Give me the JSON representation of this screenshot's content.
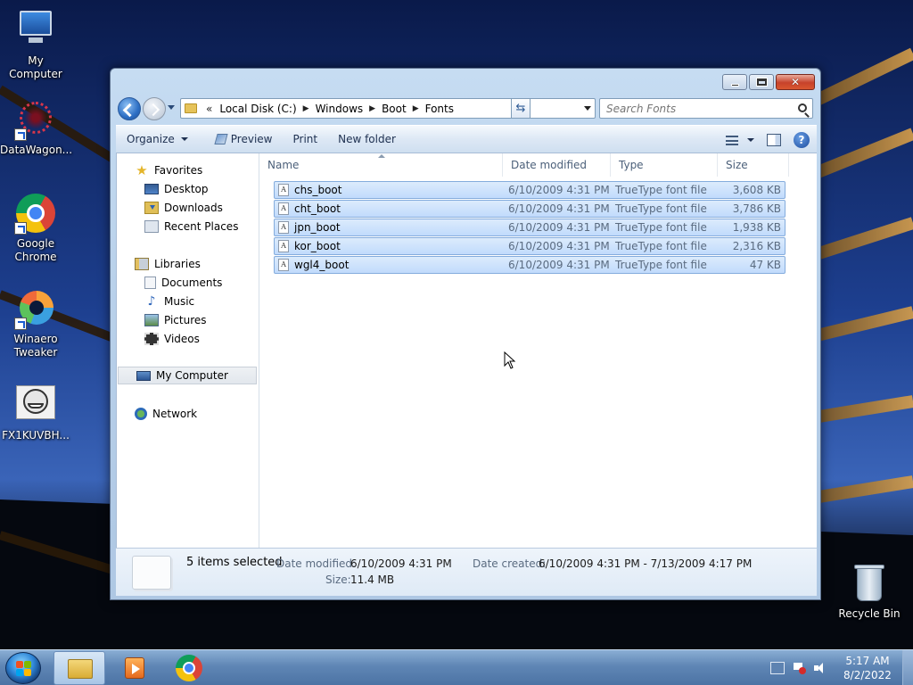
{
  "desktop": {
    "icons": [
      {
        "label": "My Computer"
      },
      {
        "label": "DataWagon..."
      },
      {
        "label": "Google Chrome"
      },
      {
        "label": "Winaero Tweaker"
      },
      {
        "label": "FX1KUVBH..."
      },
      {
        "label": "Recycle Bin"
      }
    ]
  },
  "window": {
    "address": {
      "overflow": "«",
      "segments": [
        "Local Disk (C:)",
        "Windows",
        "Boot",
        "Fonts"
      ]
    },
    "search": {
      "placeholder": "Search Fonts"
    },
    "toolbar": {
      "organize": "Organize",
      "preview": "Preview",
      "print": "Print",
      "new_folder": "New folder"
    },
    "nav": {
      "favorites": "Favorites",
      "desktop": "Desktop",
      "downloads": "Downloads",
      "recent": "Recent Places",
      "libraries": "Libraries",
      "documents": "Documents",
      "music": "Music",
      "pictures": "Pictures",
      "videos": "Videos",
      "computer": "My Computer",
      "network": "Network"
    },
    "columns": {
      "name": "Name",
      "date": "Date modified",
      "type": "Type",
      "size": "Size"
    },
    "files": [
      {
        "name": "chs_boot",
        "date": "6/10/2009 4:31 PM",
        "type": "TrueType font file",
        "size": "3,608 KB"
      },
      {
        "name": "cht_boot",
        "date": "6/10/2009 4:31 PM",
        "type": "TrueType font file",
        "size": "3,786 KB"
      },
      {
        "name": "jpn_boot",
        "date": "6/10/2009 4:31 PM",
        "type": "TrueType font file",
        "size": "1,938 KB"
      },
      {
        "name": "kor_boot",
        "date": "6/10/2009 4:31 PM",
        "type": "TrueType font file",
        "size": "2,316 KB"
      },
      {
        "name": "wgl4_boot",
        "date": "6/10/2009 4:31 PM",
        "type": "TrueType font file",
        "size": "47 KB"
      }
    ],
    "details": {
      "summary": "5 items selected",
      "modified_label": "Date modified:",
      "modified_value": "6/10/2009 4:31 PM",
      "created_label": "Date created:",
      "created_value": "6/10/2009 4:31 PM - 7/13/2009 4:17 PM",
      "size_label": "Size:",
      "size_value": "11.4 MB"
    }
  },
  "taskbar": {
    "clock_time": "5:17 AM",
    "clock_date": "8/2/2022"
  }
}
